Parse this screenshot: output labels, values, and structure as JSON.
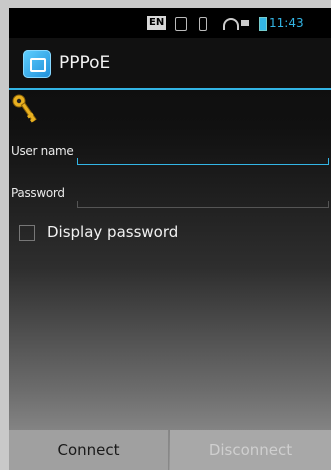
{
  "status_bar": {
    "input_indicator": "EN",
    "time": "11:43",
    "battery_color": "#33b5e5"
  },
  "action_bar": {
    "title": "PPPoE",
    "app_icon": "pppoe-app-icon",
    "accent_color": "#33b5e5"
  },
  "header_icon": "key-icon",
  "form": {
    "username_label": "User name",
    "username_value": "",
    "password_label": "Password",
    "password_value": "",
    "show_password_label": "Display password",
    "show_password_checked": false
  },
  "buttons": {
    "connect_label": "Connect",
    "disconnect_label": "Disconnect",
    "disconnect_enabled": false
  }
}
